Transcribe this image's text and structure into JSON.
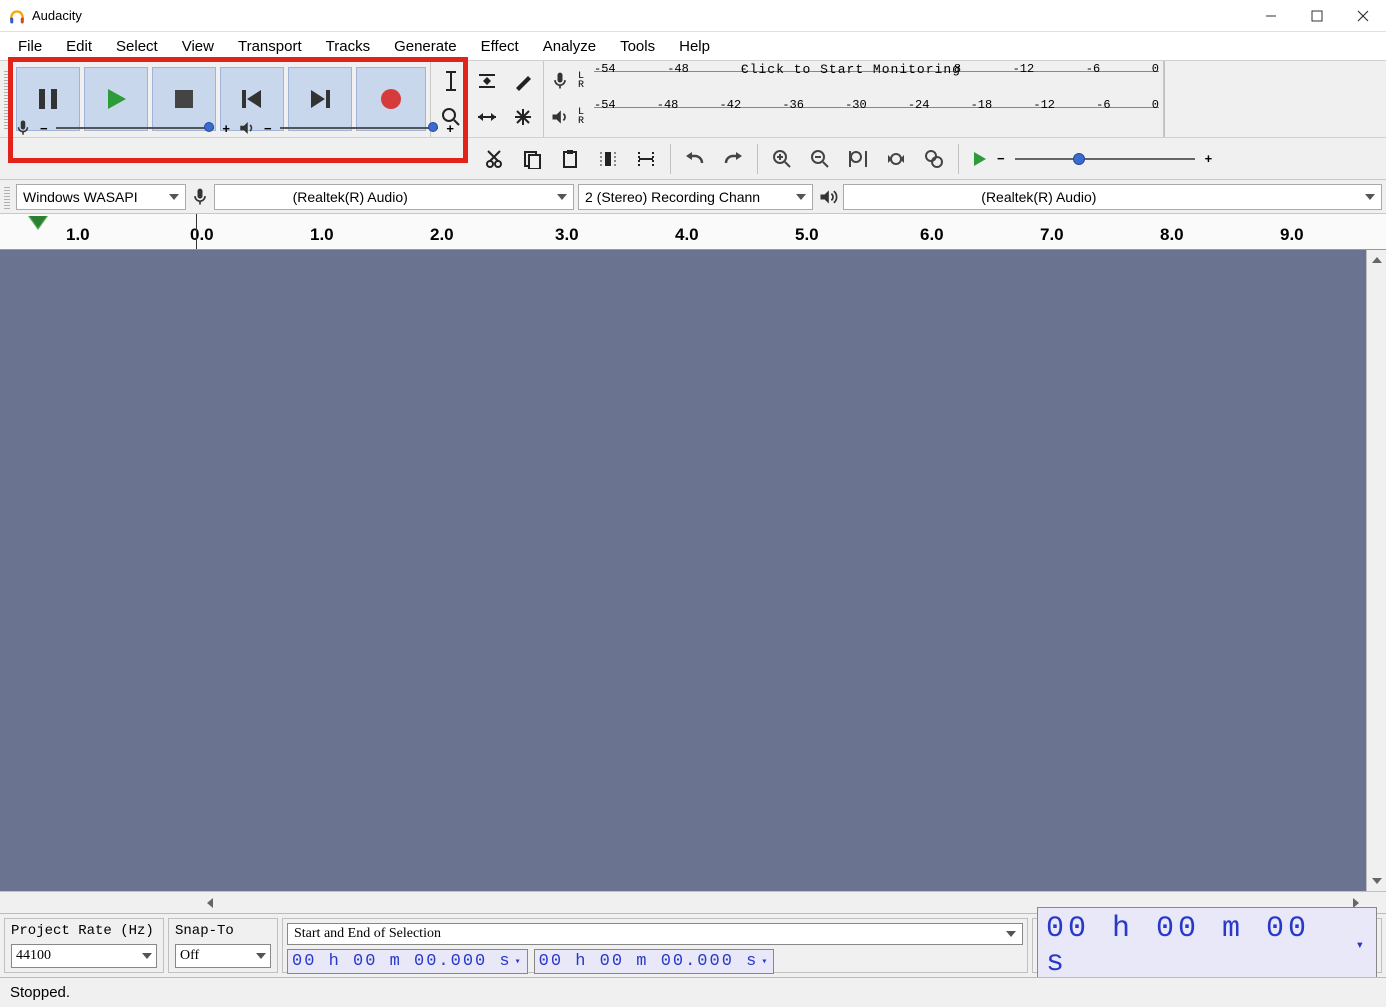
{
  "app": {
    "title": "Audacity"
  },
  "menu": {
    "file": "File",
    "edit": "Edit",
    "select": "Select",
    "view": "View",
    "transport": "Transport",
    "tracks": "Tracks",
    "generate": "Generate",
    "effect": "Effect",
    "analyze": "Analyze",
    "tools": "Tools",
    "help": "Help"
  },
  "meters": {
    "rec_hint": "Click to Start Monitoring",
    "ticks": [
      "-54",
      "-48",
      "-42",
      "-36",
      "-30",
      "-24",
      "-18",
      "-12",
      "-6",
      "0"
    ],
    "rec_ticks_visible": [
      "-54",
      "-48",
      "-",
      "8",
      "-12",
      "-6",
      "0"
    ],
    "L": "L",
    "R": "R"
  },
  "devices": {
    "host": "Windows WASAPI",
    "rec_device": "(Realtek(R) Audio)",
    "rec_channels": "2 (Stereo) Recording Chann",
    "play_device": "(Realtek(R) Audio)"
  },
  "ruler": {
    "labels": [
      "1.0",
      "0.0",
      "1.0",
      "2.0",
      "3.0",
      "4.0",
      "5.0",
      "6.0",
      "7.0",
      "8.0",
      "9.0"
    ]
  },
  "bottom": {
    "project_rate_label": "Project Rate (Hz)",
    "project_rate_value": "44100",
    "snap_label": "Snap-To",
    "snap_value": "Off",
    "selection_mode": "Start and End of Selection",
    "sel_start": "00 h 00 m 00.000 s",
    "sel_end": "00 h 00 m 00.000 s",
    "big_time": "00 h 00 m 00 s"
  },
  "status": {
    "text": "Stopped."
  },
  "symbols": {
    "minus": "−",
    "plus": "+"
  }
}
